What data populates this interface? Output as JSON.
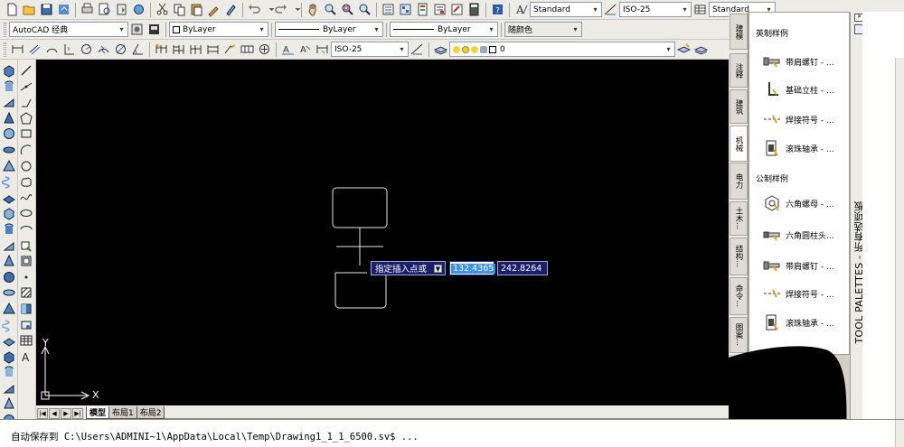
{
  "toolbar_row1": {
    "icons": [
      "new-icon",
      "open-icon",
      "save-icon",
      "plot-icon",
      "plot-preview-icon",
      "publish-icon",
      "cut-icon",
      "copy-icon",
      "paste-icon",
      "match-properties-icon",
      "block-editor-icon",
      "undo-icon",
      "redo-icon",
      "pan-icon",
      "zoom-realtime-icon",
      "zoom-window-icon",
      "zoom-previous-icon",
      "properties-icon",
      "design-center-icon",
      "tool-palettes-icon",
      "sheet-set-icon",
      "markup-icon",
      "calculator-icon",
      "help-icon"
    ],
    "text_style_label": "Standard",
    "dim_style_label": "ISO-25",
    "table_style_label": "Standard"
  },
  "toolbar_row2": {
    "workspace_label": "AutoCAD 经典",
    "layer_label": "ByLayer",
    "linetype_label": "ByLayer",
    "lineweight_label": "ByLayer",
    "plotstyle_label": "随颜色"
  },
  "toolbar_row3": {
    "dim_style_label": "ISO-25",
    "layer_current_label": "0"
  },
  "draw_toolbar": {
    "icons": [
      "line-icon",
      "construction-line-icon",
      "polyline-icon",
      "polygon-icon",
      "rectangle-icon",
      "arc-icon",
      "circle-icon",
      "revision-cloud-icon",
      "spline-icon",
      "ellipse-icon",
      "ellipse-arc-icon",
      "insert-block-icon",
      "make-block-icon",
      "point-icon",
      "hatch-icon",
      "gradient-icon",
      "region-icon",
      "table-icon",
      "multiline-text-icon"
    ]
  },
  "modify_3d_toolbar": {
    "icons": [
      "box-icon",
      "cylinder-icon",
      "wedge-icon",
      "cone-icon",
      "sphere-icon",
      "torus-icon",
      "pyramid-icon",
      "helix-icon",
      "planar-surface-icon",
      "extrude-icon",
      "revolve-icon",
      "sweep-icon",
      "loft-icon",
      "presspull-icon",
      "union-icon",
      "subtract-icon",
      "intersect-icon",
      "polysolid-icon",
      "3d-move-icon",
      "3d-rotate-icon",
      "3d-align-icon",
      "3d-array-icon",
      "slice-icon"
    ]
  },
  "layout_tabs": [
    {
      "label": "模型",
      "active": true
    },
    {
      "label": "布局1",
      "active": false
    },
    {
      "label": "布局2",
      "active": false
    }
  ],
  "ucs": {
    "x_label": "X",
    "y_label": "Y"
  },
  "dynamic_input": {
    "prompt": "指定插入点或",
    "value_x": "132.4365",
    "value_y": "242.8264"
  },
  "command_line": {
    "text": "自动保存到 C:\\Users\\ADMINI~1\\AppData\\Local\\Temp\\Drawing1_1_1_6500.sv$ ..."
  },
  "tool_palette": {
    "title": "TOOL PALETTES - 所有选项板",
    "tabs": [
      "建模",
      "注释",
      "建筑",
      "机械",
      "电力",
      "土木...",
      "结构...",
      "命令...",
      "图案..."
    ],
    "section1_header": "英制样例",
    "section1_items": [
      "带肩螺钉 - ...",
      "基础立柱 - ...",
      "焊接符号 - ...",
      "滚珠轴承 - ..."
    ],
    "section2_header": "公制样例",
    "section2_items": [
      "六角螺母 - ...",
      "六角圆柱头...",
      "带肩螺钉 - ...",
      "焊接符号 - ...",
      "滚珠轴承 - ..."
    ]
  },
  "colors": {
    "canvas": "#000000",
    "toolbar_bg": "#ecebe6",
    "dyn_input_bg": "#1b1f6b",
    "dyn_input_selected": "#3a8ff2"
  }
}
